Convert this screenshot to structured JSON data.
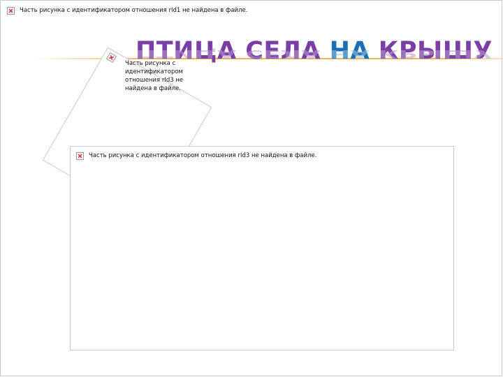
{
  "slide": {
    "top_placeholder_text": "Часть рисунка с идентификатором отношения rId1 не найдена в файле.",
    "title_part1": "ПТИЦА СЕЛА",
    "title_part2": "НА",
    "title_part3": "КРЫШУ",
    "rotated_placeholder_lines": [
      "Часть рисунка с",
      "идентификатором",
      "отношения rId3 не",
      "найдена в файле."
    ],
    "main_placeholder_text": "Часть рисунка с идентификатором отношения rId3 не найдена в файле."
  },
  "colors": {
    "title_purple": "#7a3fa6",
    "title_blue": "#1c6fb7",
    "accent_line": "#e8b74e"
  }
}
